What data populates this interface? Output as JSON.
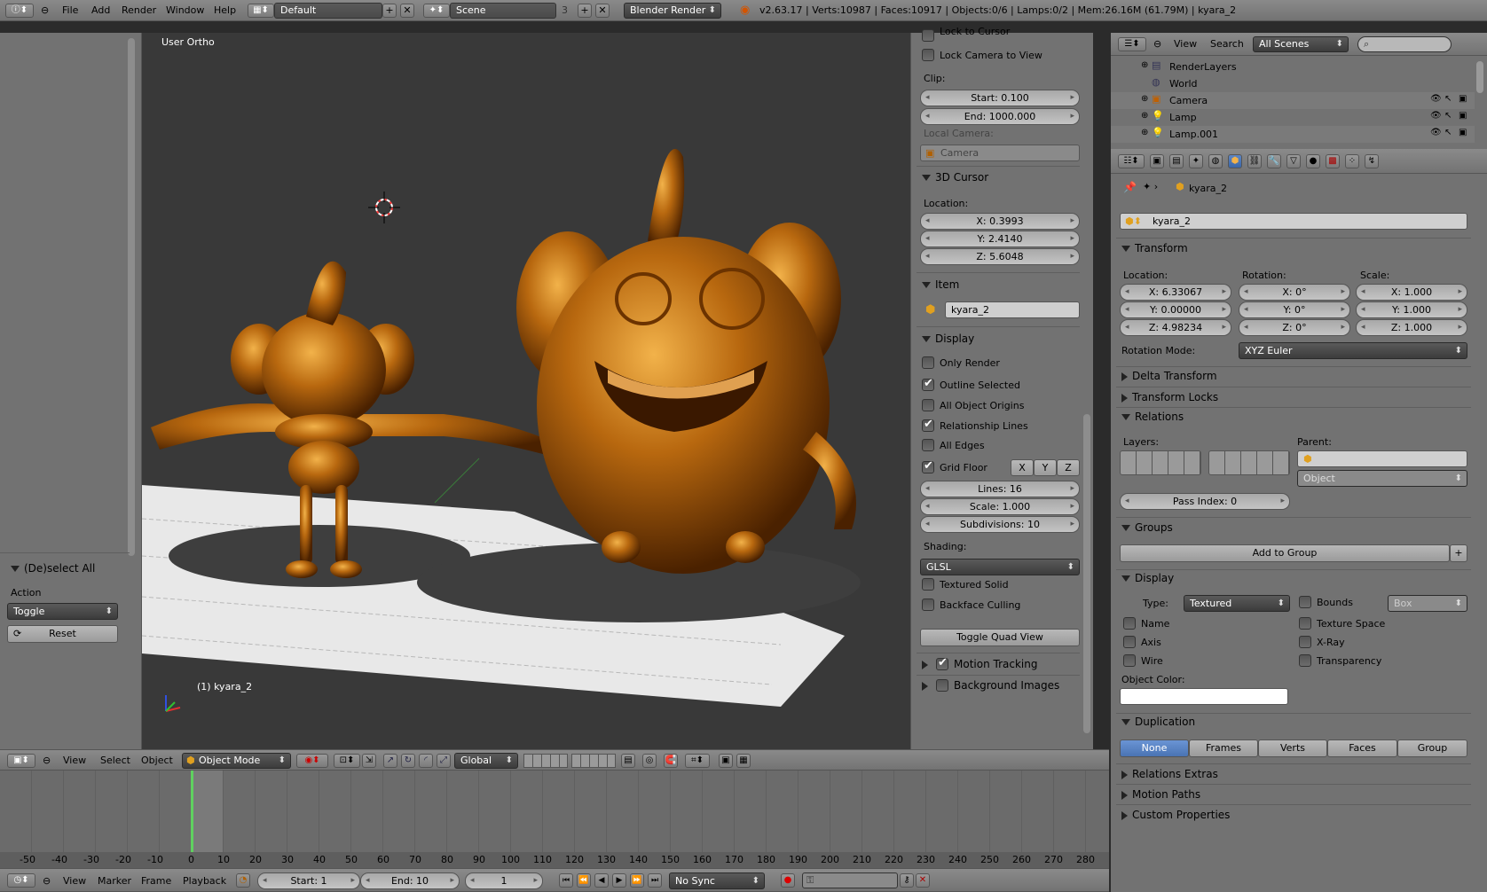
{
  "topbar": {
    "menus": [
      "File",
      "Add",
      "Render",
      "Window",
      "Help"
    ],
    "layout": "Default",
    "scene": "Scene",
    "scene_users": "3",
    "engine": "Blender Render",
    "stats": "v2.63.17 | Verts:10987 | Faces:10917 | Objects:0/6 | Lamps:0/2 | Mem:26.16M (61.79M) | kyara_2"
  },
  "viewport": {
    "view_name": "User Ortho",
    "object_label": "(1) kyara_2"
  },
  "toolshelf": {
    "op_title": "(De)select All",
    "action_label": "Action",
    "action_value": "Toggle",
    "reset_label": "Reset"
  },
  "npanel": {
    "lock_cursor": "Lock to Cursor",
    "lock_camera": "Lock Camera to View",
    "clip_label": "Clip:",
    "clip_start": "Start: 0.100",
    "clip_end": "End: 1000.000",
    "local_camera_label": "Local Camera:",
    "local_camera": "Camera",
    "cursor_title": "3D Cursor",
    "location_label": "Location:",
    "cx": "X: 0.3993",
    "cy": "Y: 2.4140",
    "cz": "Z: 5.6048",
    "item_title": "Item",
    "item_name": "kyara_2",
    "display_title": "Display",
    "only_render": "Only Render",
    "outline_selected": "Outline Selected",
    "all_origins": "All Object Origins",
    "relationship_lines": "Relationship Lines",
    "all_edges": "All Edges",
    "grid_floor": "Grid Floor",
    "axis_x": "X",
    "axis_y": "Y",
    "axis_z": "Z",
    "lines": "Lines: 16",
    "scale": "Scale: 1.000",
    "subdivisions": "Subdivisions: 10",
    "shading_label": "Shading:",
    "shading": "GLSL",
    "textured_solid": "Textured Solid",
    "backface": "Backface Culling",
    "quad_view": "Toggle Quad View",
    "motion_tracking": "Motion Tracking",
    "background_images": "Background Images"
  },
  "view3d_header": {
    "menus": [
      "View",
      "Select",
      "Object"
    ],
    "mode": "Object Mode",
    "orientation": "Global"
  },
  "outliner": {
    "view": "View",
    "search": "Search",
    "scenes": "All Scenes",
    "items": [
      "RenderLayers",
      "World",
      "Camera",
      "Lamp",
      "Lamp.001"
    ]
  },
  "properties": {
    "breadcrumb": "kyara_2",
    "object_name": "kyara_2",
    "transform_title": "Transform",
    "location_label": "Location:",
    "rotation_label": "Rotation:",
    "scale_label": "Scale:",
    "lx": "X: 6.33067",
    "ly": "Y: 0.00000",
    "lz": "Z: 4.98234",
    "rx": "X: 0°",
    "ry": "Y: 0°",
    "rz": "Z: 0°",
    "sx": "X: 1.000",
    "sy": "Y: 1.000",
    "sz": "Z: 1.000",
    "rotation_mode_label": "Rotation Mode:",
    "rotation_mode": "XYZ Euler",
    "delta_transform": "Delta Transform",
    "transform_locks": "Transform Locks",
    "relations_title": "Relations",
    "layers_label": "Layers:",
    "parent_label": "Parent:",
    "parent_type": "Object",
    "pass_index": "Pass Index: 0",
    "groups_title": "Groups",
    "add_to_group": "Add to Group",
    "display_title": "Display",
    "type_label": "Type:",
    "type_value": "Textured",
    "bounds": "Bounds",
    "bounds_type": "Box",
    "name": "Name",
    "texture_space": "Texture Space",
    "axis": "Axis",
    "xray": "X-Ray",
    "wire": "Wire",
    "transparency": "Transparency",
    "object_color_label": "Object Color:",
    "duplication_title": "Duplication",
    "dup_options": [
      "None",
      "Frames",
      "Verts",
      "Faces",
      "Group"
    ],
    "relations_extras": "Relations Extras",
    "motion_paths": "Motion Paths",
    "custom_properties": "Custom Properties"
  },
  "timeline": {
    "ruler": [
      "-50",
      "-40",
      "-30",
      "-20",
      "-10",
      "0",
      "10",
      "20",
      "30",
      "40",
      "50",
      "60",
      "70",
      "80",
      "90",
      "100",
      "110",
      "120",
      "130",
      "140",
      "150",
      "160",
      "170",
      "180",
      "190",
      "200",
      "210",
      "220",
      "230",
      "240",
      "250",
      "260",
      "270",
      "280"
    ],
    "menus": [
      "View",
      "Marker",
      "Frame",
      "Playback"
    ],
    "start": "Start: 1",
    "end": "End: 10",
    "current": "1",
    "sync": "No Sync"
  }
}
